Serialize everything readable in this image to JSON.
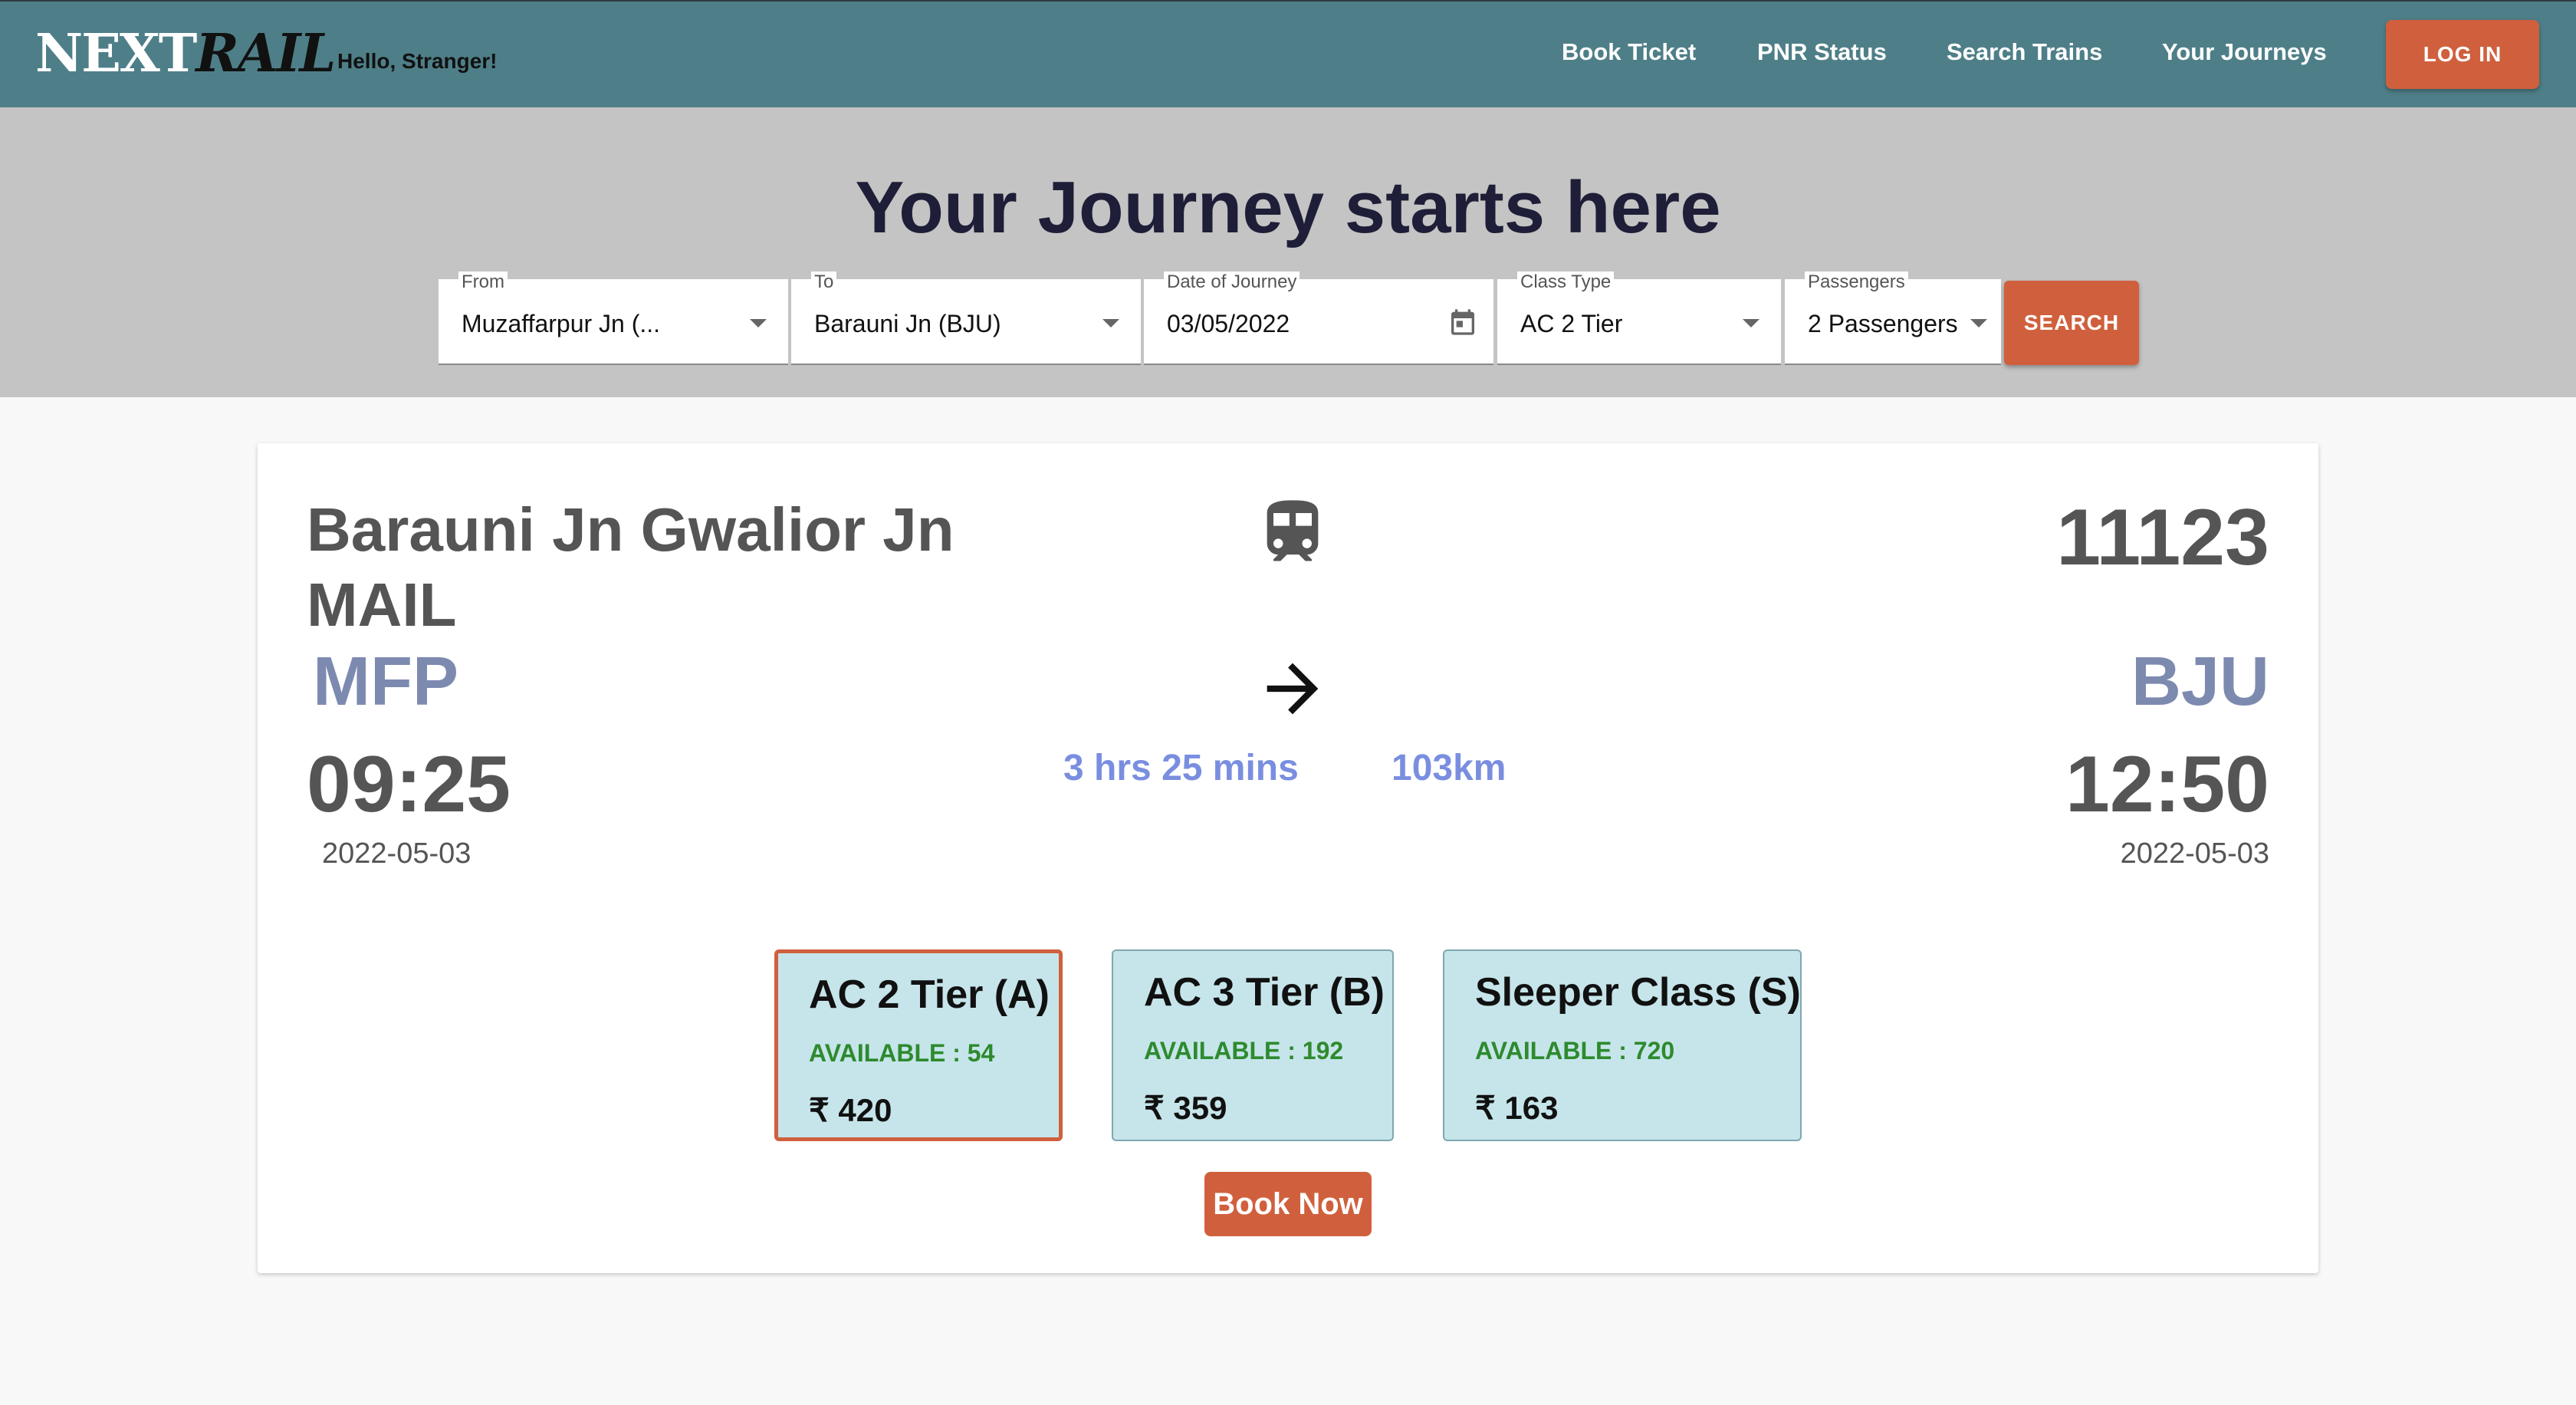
{
  "header": {
    "brand_part1": "NEXT",
    "brand_part2": "RAIL",
    "greeting": "Hello, Stranger!",
    "nav": [
      "Book Ticket",
      "PNR Status",
      "Search Trains",
      "Your Journeys"
    ],
    "login_label": "LOG IN"
  },
  "search": {
    "title": "Your Journey starts here",
    "from_label": "From",
    "from_value": "Muzaffarpur Jn (...",
    "to_label": "To",
    "to_value": "Barauni Jn (BJU)",
    "date_label": "Date of Journey",
    "date_value": "03/05/2022",
    "class_label": "Class Type",
    "class_value": "AC 2 Tier",
    "passengers_label": "Passengers",
    "passengers_value": "2 Passengers",
    "search_label": "SEARCH"
  },
  "train": {
    "name": "Barauni Jn Gwalior Jn MAIL",
    "number": "11123",
    "from_code": "MFP",
    "to_code": "BJU",
    "depart_time": "09:25",
    "arrive_time": "12:50",
    "depart_date": "2022-05-03",
    "arrive_date": "2022-05-03",
    "duration": "3 hrs 25 mins",
    "distance": "103km",
    "classes": [
      {
        "name": "AC 2 Tier (A)",
        "availability": "AVAILABLE : 54",
        "price": "₹ 420"
      },
      {
        "name": "AC 3 Tier (B)",
        "availability": "AVAILABLE : 192",
        "price": "₹ 359"
      },
      {
        "name": "Sleeper Class (S)",
        "availability": "AVAILABLE : 720",
        "price": "₹ 163"
      }
    ],
    "book_label": "Book Now"
  },
  "icons": {
    "train": "train-icon",
    "arrow": "arrow-right-icon",
    "calendar": "calendar-icon",
    "caret": "chevron-down-icon"
  },
  "colors": {
    "header_bg": "#4e7f88",
    "accent": "#d0603d",
    "station_code": "#7d8ab0",
    "stat_text": "#7a8ee0",
    "available_text": "#2e8a2e",
    "class_card_bg": "#c6e5ea"
  }
}
